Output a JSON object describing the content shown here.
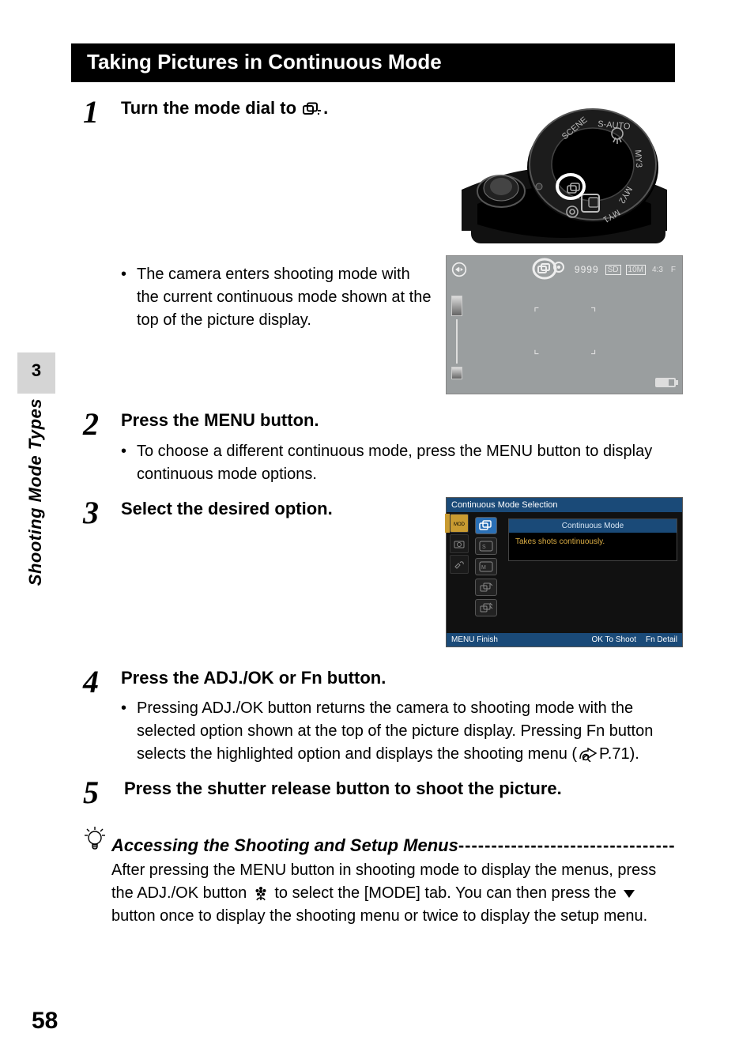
{
  "section_title": "Taking Pictures in Continuous Mode",
  "chapter": {
    "number": "3",
    "title": "Shooting Mode Types"
  },
  "page_number": "58",
  "steps": {
    "s1": {
      "num": "1",
      "heading_before": "Turn the mode dial to ",
      "heading_after": ".",
      "bullet": "The camera enters shooting mode with the current continuous mode shown at the top of the picture display."
    },
    "s2": {
      "num": "2",
      "heading": "Press the MENU button.",
      "bullet": "To choose a different continuous mode, press the MENU button to display continuous mode options."
    },
    "s3": {
      "num": "3",
      "heading": "Select the desired option."
    },
    "s4": {
      "num": "4",
      "heading": "Press the ADJ./OK or Fn button.",
      "bullet_before": "Pressing ADJ./OK button returns the camera to shooting mode with the selected option shown at the top of the picture display. Pressing Fn button selects the highlighted option and displays the shooting menu (",
      "bullet_after": "P.71)."
    },
    "s5": {
      "num": "5",
      "heading": " Press the shutter release button to shoot the picture."
    }
  },
  "note": {
    "heading": "Accessing the Shooting and Setup Menus",
    "dashes": "--------------------------------------",
    "text_l1": "After pressing the MENU button in shooting mode to display the menus, press the ADJ./OK button ",
    "text_l2": " to select the [MODE] tab. You can then press the ",
    "text_l3": " button once to display the shooting menu or twice to display the setup menu."
  },
  "lcd1": {
    "counter": "9999",
    "sd": "SD",
    "size": "10M",
    "ratio": "4:3",
    "quality": "F"
  },
  "dial": {
    "labels": [
      "S-AUTO",
      "SCENE",
      "MY3",
      "MY2",
      "MY1"
    ]
  },
  "lcd2": {
    "title": "Continuous Mode Selection",
    "panel_title": "Continuous Mode",
    "panel_text": "Takes shots continuously.",
    "footer_left": "MENU Finish",
    "footer_ok": "OK  To Shoot",
    "footer_fn": "Fn  Detail"
  }
}
